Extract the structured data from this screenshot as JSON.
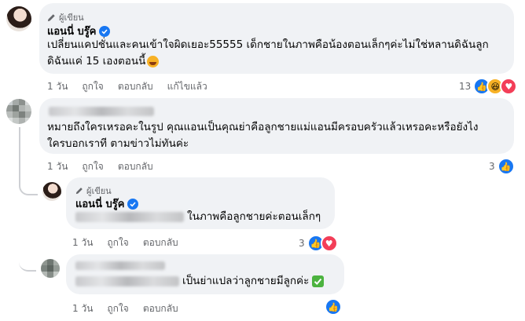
{
  "author_badge": "ผู้เขียน",
  "author_name": "แอนนี่ บรู๊ค",
  "comments": [
    {
      "text_line1": "เปลี่ยนแคปชั่นและคนเข้าใจผิดเยอะ55555 เด็กชายในภาพคือน้องตอนเล็กๆค่ะไม่ใช่หลานดิฉันลูก",
      "text_line2": "ดิฉันแค่ 15 เองตอนนี้",
      "time": "1 วัน",
      "like": "ถูกใจ",
      "reply": "ตอบกลับ",
      "edited": "แก้ไขแล้ว",
      "reaction_count": "13"
    },
    {
      "text_line1": "หมายถึงใครเหรอคะในรูป คุณแอนเป็นคุณย่าคือลูกชายแม่แอนมีครอบครัวแล้วเหรอคะหรือยังไง",
      "text_line2": "ใครบอกเราที ตามข่าวไม่ทันค่ะ",
      "time": "1 วัน",
      "like": "ถูกใจ",
      "reply": "ตอบกลับ",
      "reaction_count": "3"
    },
    {
      "text": "ในภาพคือลูกชายค่ะตอนเล็กๆ",
      "time": "1 วัน",
      "like": "ถูกใจ",
      "reply": "ตอบกลับ",
      "reaction_count": "3"
    },
    {
      "text": "เป็นย่าแปลว่าลูกชายมีลูกค่ะ",
      "time": "1 วัน",
      "like": "ถูกใจ",
      "reply": "ตอบกลับ"
    }
  ],
  "colors": {
    "bubble": "#f0f2f5",
    "meta": "#65676b",
    "like_blue": "#1877f2",
    "love_red": "#f33e58",
    "haha_yellow": "#f7b125"
  },
  "icons": [
    "pencil-icon",
    "verified-badge-icon",
    "like-icon",
    "haha-icon",
    "love-icon",
    "check-emoji-icon",
    "grin-emoji-icon"
  ]
}
